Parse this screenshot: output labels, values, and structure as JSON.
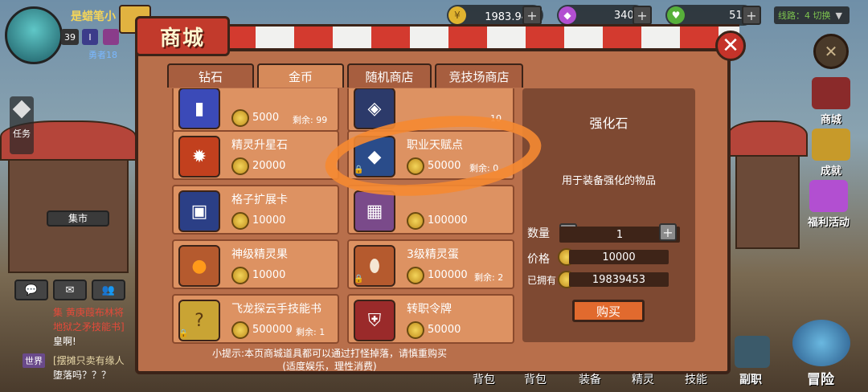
{
  "player": {
    "name": "是蜡笔小",
    "level": "39",
    "rank_icon_1": "I",
    "rank_title": "勇者18"
  },
  "resources": [
    {
      "icon": "gold-coin-icon",
      "value": "1983.94万"
    },
    {
      "icon": "diamond-icon",
      "value": "3403"
    },
    {
      "icon": "heart-icon",
      "value": "510"
    }
  ],
  "line_select": "线路：4 切换",
  "shop": {
    "title": "商城",
    "tabs": [
      {
        "label": "钻石",
        "active": false
      },
      {
        "label": "金币",
        "active": true
      },
      {
        "label": "随机商店",
        "active": false
      },
      {
        "label": "竞技场商店",
        "active": false
      }
    ],
    "items": [
      {
        "name": "",
        "price": "5000",
        "remain_label": "剩余:",
        "remain": "99",
        "locked": true,
        "icon": "blue-potion-icon"
      },
      {
        "name": "",
        "price": "",
        "remain_label": "",
        "remain": "10",
        "locked": true,
        "icon": "rune-icon"
      },
      {
        "name": "精灵升星石",
        "price": "20000",
        "remain_label": "",
        "remain": "",
        "locked": false,
        "icon": "fire-stone-icon"
      },
      {
        "name": "职业天赋点",
        "price": "50000",
        "remain_label": "剩余:",
        "remain": "0",
        "locked": true,
        "icon": "talent-gem-icon"
      },
      {
        "name": "格子扩展卡",
        "price": "10000",
        "remain_label": "",
        "remain": "",
        "locked": false,
        "icon": "card-icon"
      },
      {
        "name": "",
        "price": "100000",
        "remain_label": "",
        "remain": "",
        "locked": false,
        "icon": "treasure-chest-icon"
      },
      {
        "name": "神级精灵果",
        "price": "10000",
        "remain_label": "",
        "remain": "",
        "locked": false,
        "icon": "orange-fruit-icon"
      },
      {
        "name": "3级精灵蛋",
        "price": "100000",
        "remain_label": "剩余:",
        "remain": "2",
        "locked": true,
        "icon": "egg-icon"
      },
      {
        "name": "飞龙探云手技能书",
        "price": "500000",
        "remain_label": "剩余:",
        "remain": "1",
        "locked": true,
        "icon": "skill-book-icon"
      },
      {
        "name": "转职令牌",
        "price": "50000",
        "remain_label": "",
        "remain": "",
        "locked": false,
        "icon": "token-icon"
      }
    ],
    "detail": {
      "title": "强化石",
      "description": "用于装备强化的物品",
      "qty_label": "数量",
      "qty": "1",
      "price_label": "价格",
      "price": "10000",
      "owned_label": "已拥有",
      "owned": "19839453",
      "buy_label": "购买"
    },
    "tip_line1": "小提示:本页商城道具都可以通过打怪掉落，请慎重购买",
    "tip_line2": "(适度娱乐，理性消费)"
  },
  "side_menu": [
    "商城",
    "成就",
    "福利活动"
  ],
  "left_menu": {
    "task": "任务",
    "market": "集市"
  },
  "chat": {
    "line1": "集 黄庚葭布林将",
    "line2": "地狱之矛技能书]",
    "line3": "皇啊!",
    "channel": "世界",
    "line4": "[摆摊只卖有缘人",
    "line5": "堕落吗？？？"
  },
  "bottom_nav": [
    "背包",
    "背包",
    "装备",
    "精灵",
    "技能",
    "副职",
    "冒险"
  ],
  "colors": {
    "accent_red": "#c5332a",
    "panel": "#b86f4b",
    "annotation": "#f58a32"
  }
}
